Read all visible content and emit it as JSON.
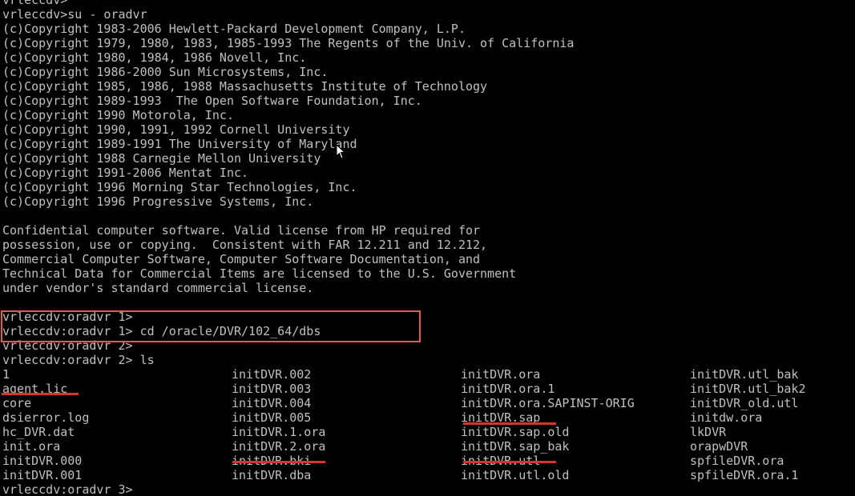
{
  "terminal": {
    "header_lines": [
      "vrleccdv>",
      "vrleccdv>su - oradvr",
      "(c)Copyright 1983-2006 Hewlett-Packard Development Company, L.P.",
      "(c)Copyright 1979, 1980, 1983, 1985-1993 The Regents of the Univ. of California",
      "(c)Copyright 1980, 1984, 1986 Novell, Inc.",
      "(c)Copyright 1986-2000 Sun Microsystems, Inc.",
      "(c)Copyright 1985, 1986, 1988 Massachusetts Institute of Technology",
      "(c)Copyright 1989-1993  The Open Software Foundation, Inc.",
      "(c)Copyright 1990 Motorola, Inc.",
      "(c)Copyright 1990, 1991, 1992 Cornell University",
      "(c)Copyright 1989-1991 The University of Maryland",
      "(c)Copyright 1988 Carnegie Mellon University",
      "(c)Copyright 1991-2006 Mentat Inc.",
      "(c)Copyright 1996 Morning Star Technologies, Inc.",
      "(c)Copyright 1996 Progressive Systems, Inc.",
      "",
      "Confidential computer software. Valid license from HP required for",
      "possession, use or copying.  Consistent with FAR 12.211 and 12.212,",
      "Commercial Computer Software, Computer Software Documentation, and",
      "Technical Data for Commercial Items are licensed to the U.S. Government",
      "under vendor's standard commercial license.",
      "",
      "vrleccdv:oradvr 1>",
      "vrleccdv:oradvr 1> cd /oracle/DVR/102_64/dbs",
      "vrleccdv:oradvr 2>",
      "vrleccdv:oradvr 2> ls"
    ],
    "ls_rows": [
      [
        "1",
        "initDVR.002",
        "initDVR.ora",
        "initDVR.utl_bak"
      ],
      [
        "agent.lic",
        "initDVR.003",
        "initDVR.ora.1",
        "initDVR.utl_bak2"
      ],
      [
        "core",
        "initDVR.004",
        "initDVR.ora.SAPINST-ORIG",
        "initDVR_old.utl"
      ],
      [
        "dsierror.log",
        "initDVR.005",
        "initDVR.sap",
        "initdw.ora"
      ],
      [
        "hc_DVR.dat",
        "initDVR.1.ora",
        "initDVR.sap.old",
        "lkDVR"
      ],
      [
        "init.ora",
        "initDVR.2.ora",
        "initDVR.sap_bak",
        "orapwDVR"
      ],
      [
        "initDVR.000",
        "initDVR.bki",
        "initDVR.utl",
        "spfileDVR.ora"
      ],
      [
        "initDVR.001",
        "initDVR.dba",
        "initDVR.utl.old",
        "spfileDVR.ora.1"
      ]
    ],
    "final_prompt": "vrleccdv:oradvr 3>",
    "annotation_color": "#d9342b",
    "text_color": "#c0c0c0",
    "background_color": "#000000"
  }
}
